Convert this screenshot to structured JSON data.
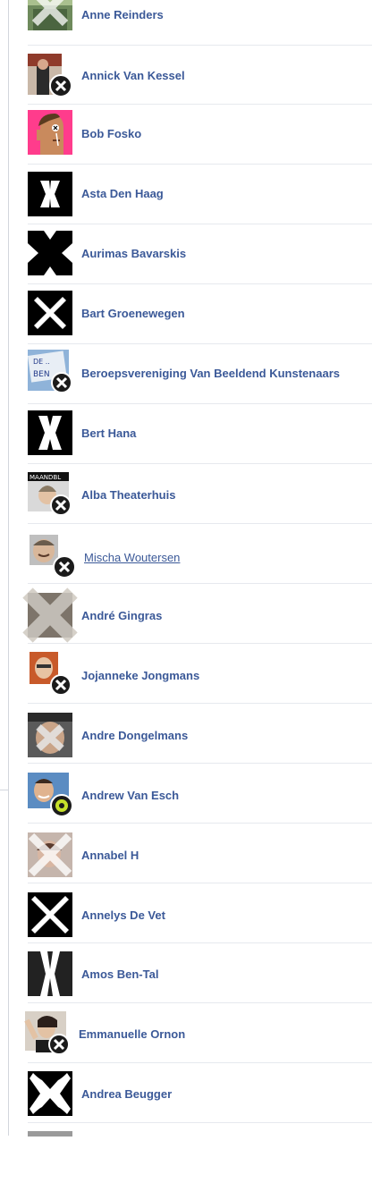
{
  "friends": [
    {
      "name": "Anne Reinders"
    },
    {
      "name": "Annick Van Kessel"
    },
    {
      "name": "Bob Fosko"
    },
    {
      "name": "Asta Den Haag"
    },
    {
      "name": "Aurimas Bavarskis"
    },
    {
      "name": "Bart Groenewegen"
    },
    {
      "name": "Beroepsvereniging Van Beeldend Kunstenaars"
    },
    {
      "name": "Bert Hana"
    },
    {
      "name": "Alba Theaterhuis"
    },
    {
      "name": "Mischa Woutersen"
    },
    {
      "name": "André Gingras"
    },
    {
      "name": "Jojanneke Jongmans"
    },
    {
      "name": "Andre Dongelmans"
    },
    {
      "name": "Andrew Van Esch"
    },
    {
      "name": "Annabel H"
    },
    {
      "name": "Annelys De Vet"
    },
    {
      "name": "Amos Ben-Tal"
    },
    {
      "name": "Emmanuelle Ornon"
    },
    {
      "name": "Andrea Beugger"
    }
  ],
  "colors": {
    "link": "#3b5998",
    "divider": "#e6e9ee",
    "rail": "#d3d6dd"
  }
}
